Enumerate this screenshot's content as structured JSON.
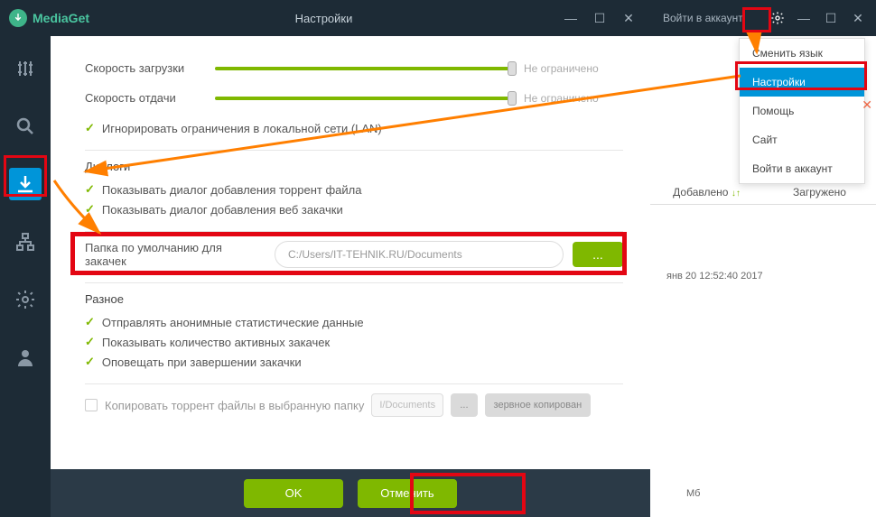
{
  "app": {
    "name": "MediaGet",
    "windowTitle": "Настройки"
  },
  "winControls": {
    "min": "—",
    "max": "☐",
    "close": "✕"
  },
  "sidebar": {
    "items": [
      {
        "name": "equalizer"
      },
      {
        "name": "search"
      },
      {
        "name": "downloads"
      },
      {
        "name": "network"
      },
      {
        "name": "settings"
      },
      {
        "name": "user"
      }
    ]
  },
  "settings": {
    "downloadSpeed": {
      "label": "Скорость загрузки",
      "status": "Не ограничено"
    },
    "uploadSpeed": {
      "label": "Скорость отдачи",
      "status": "Не ограничено"
    },
    "ignoreLan": "Игнорировать ограничения в локальной сети (LAN)",
    "dialogsTitle": "Диалоги",
    "showTorrentDialog": "Показывать диалог добавления торрент файла",
    "showWebDialog": "Показывать диалог добавления веб закачки",
    "defaultFolderLabel": "Папка по умолчанию для закачек",
    "defaultFolderPath": "C:/Users/IT-TEHNIK.RU/Documents",
    "browseBtn": "...",
    "miscTitle": "Разное",
    "sendAnonStats": "Отправлять анонимные статистические данные",
    "showActiveCount": "Показывать количество активных закачек",
    "notifyOnFinish": "Оповещать при завершении закачки",
    "copyTorrents": "Копировать торрент файлы в выбранную папку",
    "copyPath": "I/Documents",
    "copyBrowse": "...",
    "backupCopy": "зервное копирован"
  },
  "buttons": {
    "ok": "OK",
    "cancel": "Отменить"
  },
  "rightPanel": {
    "login": "Войти в аккаунт",
    "menu": {
      "changeLang": "Сменить язык",
      "settings": "Настройки",
      "help": "Помощь",
      "site": "Сайт",
      "login": "Войти в аккаунт"
    },
    "tabs": {
      "added": "Добавлено",
      "loaded": "Загружено"
    },
    "timestamp": "янв 20 12:52:40 2017",
    "bottomUnit": "Мб"
  }
}
